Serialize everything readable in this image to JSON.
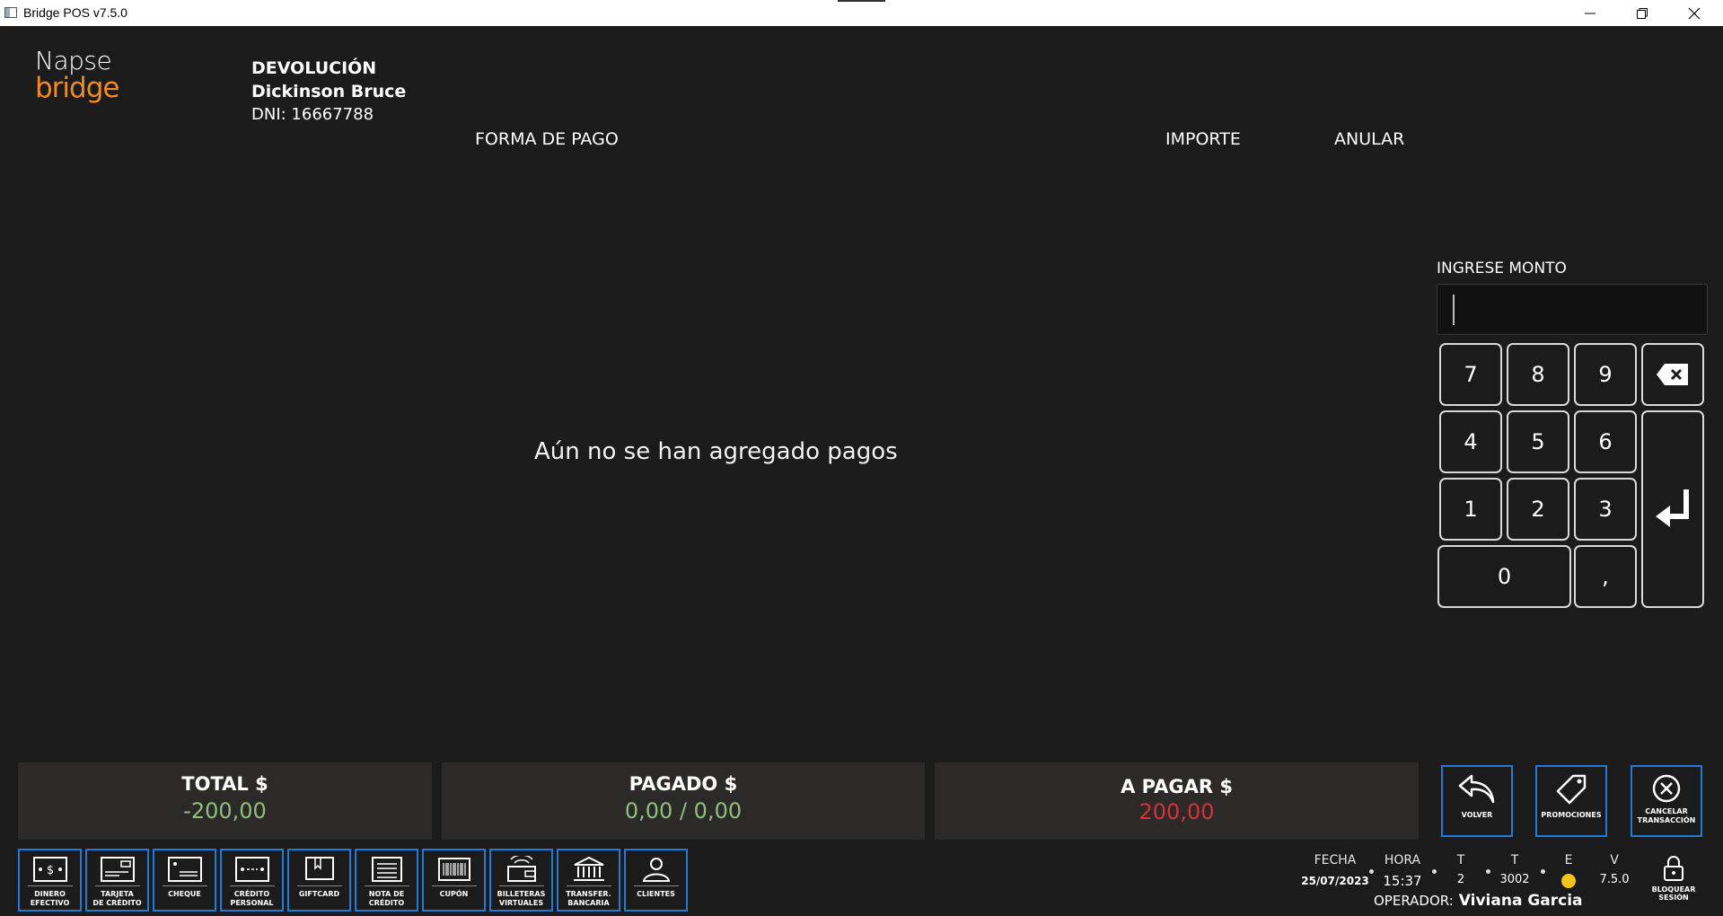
{
  "window": {
    "title": "Bridge POS v7.5.0"
  },
  "logo": {
    "line1": "Napse",
    "line2": "bridge"
  },
  "client": {
    "type": "DEVOLUCIÓN",
    "name": "Dickinson Bruce",
    "dni": "DNI: 16667788"
  },
  "columns": {
    "payment": "FORMA DE PAGO",
    "amount": "IMPORTE",
    "cancel": "ANULAR"
  },
  "empty_message": "Aún no se han agregado pagos",
  "keypad": {
    "label": "INGRESE MONTO",
    "value": "",
    "keys": [
      "7",
      "8",
      "9",
      "4",
      "5",
      "6",
      "1",
      "2",
      "3",
      "0",
      ","
    ]
  },
  "totals": {
    "total": {
      "label": "TOTAL $",
      "value": "-200,00"
    },
    "paid": {
      "label": "PAGADO $",
      "value": "0,00 / 0,00"
    },
    "due": {
      "label": "A PAGAR $",
      "value": "200,00"
    }
  },
  "actions": {
    "back": "VOLVER",
    "promotions": "PROMOCIONES",
    "cancel_l1": "CANCELAR",
    "cancel_l2": "TRANSACCIÓN"
  },
  "payment_methods": [
    {
      "l1": "DINERO",
      "l2": "EFECTIVO"
    },
    {
      "l1": "TARJETA",
      "l2": "DE CRÉDITO"
    },
    {
      "l1": "CHEQUE",
      "l2": ""
    },
    {
      "l1": "CRÉDITO",
      "l2": "PERSONAL"
    },
    {
      "l1": "GIFTCARD",
      "l2": ""
    },
    {
      "l1": "NOTA DE",
      "l2": "CRÉDITO"
    },
    {
      "l1": "CUPÓN",
      "l2": ""
    },
    {
      "l1": "BILLETERAS",
      "l2": "VIRTUALES"
    },
    {
      "l1": "TRANSFER.",
      "l2": "BANCARIA"
    },
    {
      "l1": "CLIENTES",
      "l2": ""
    }
  ],
  "status": {
    "fecha_label": "FECHA",
    "fecha": "25/07/2023",
    "hora_label": "HORA",
    "hora": "15:37",
    "t1_label": "T",
    "t1": "2",
    "t2_label": "T",
    "t2": "3002",
    "e_label": "E",
    "v_label": "V",
    "v": "7.5.0",
    "lock_l1": "BLOQUEAR",
    "lock_l2": "SESIÓN",
    "operator_label": "OPERADOR:",
    "operator": "Viviana Garcia"
  },
  "colors": {
    "accent_blue": "#1f7ad8",
    "positive_green": "#8fbf7a",
    "due_red": "#d9303a",
    "status_yellow": "#f3c318",
    "brand_orange": "#f08a24"
  }
}
